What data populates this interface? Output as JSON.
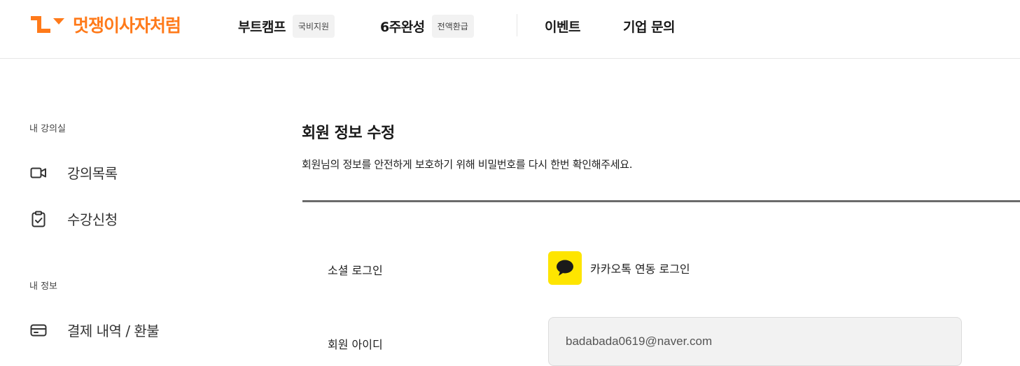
{
  "header": {
    "logo_text": "멋쟁이사자처럼",
    "nav": [
      {
        "label": "부트캠프",
        "badge": "국비지원"
      },
      {
        "label": "6주완성",
        "badge": "전액환급"
      },
      {
        "label": "이벤트"
      },
      {
        "label": "기업 문의"
      }
    ]
  },
  "sidebar": {
    "section1": "내 강의실",
    "section2": "내 정보",
    "items": [
      {
        "label": "강의목록",
        "icon": "video-camera-icon"
      },
      {
        "label": "수강신청",
        "icon": "clipboard-check-icon"
      },
      {
        "label": "결제 내역 / 환불",
        "icon": "credit-card-icon"
      }
    ]
  },
  "main": {
    "title": "회원 정보 수정",
    "description": "회원님의 정보를 안전하게 보호하기 위해 비밀번호를 다시 한번 확인해주세요.",
    "social_label": "소셜 로그인",
    "social_value": "카카오톡 연동 로그인",
    "id_label": "회원 아이디",
    "id_value": "badabada0619@naver.com"
  },
  "colors": {
    "brand": "#ff7a1a",
    "kakao": "#fee500"
  }
}
